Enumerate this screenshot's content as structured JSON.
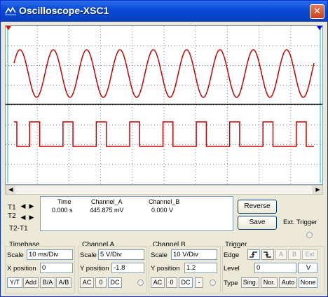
{
  "window": {
    "title": "Oscilloscope-XSC1",
    "close_glyph": "✕"
  },
  "cursor": {
    "t1": "T1",
    "t2": "T2",
    "t2_t1": "T2-T1",
    "left_arrow": "◀",
    "right_arrow": "▶"
  },
  "readout": {
    "headers": {
      "time": "Time",
      "channel_a": "Channel_A",
      "channel_b": "Channel_B"
    },
    "t1_row": {
      "time": "0.000 s",
      "channel_a": "445.875 mV",
      "channel_b": "0.000 V"
    }
  },
  "buttons": {
    "reverse": "Reverse",
    "save": "Save",
    "ext_trigger": "Ext. Trigger"
  },
  "timebase": {
    "title": "Timebase",
    "scale_label": "Scale",
    "scale_value": "10 ms/Div",
    "xpos_label": "X position",
    "xpos_value": "0",
    "modes": [
      "Y/T",
      "Add",
      "B/A",
      "A/B"
    ]
  },
  "channel_a": {
    "title": "Channel A",
    "scale_label": "Scale",
    "scale_value": "5  V/Div",
    "ypos_label": "Y position",
    "ypos_value": "-1.8",
    "coupling": [
      "AC",
      "0",
      "DC"
    ]
  },
  "channel_b": {
    "title": "Channel B",
    "scale_label": "Scale",
    "scale_value": "10  V/Div",
    "ypos_label": "Y position",
    "ypos_value": "1.2",
    "coupling": [
      "AC",
      "0",
      "DC",
      "-"
    ]
  },
  "trigger": {
    "title": "Trigger",
    "edge_label": "Edge",
    "edge_sources": [
      "A",
      "B",
      "Ext"
    ],
    "level_label": "Level",
    "level_value": "0",
    "level_unit": "V",
    "type_label": "Type",
    "types": [
      "Sing.",
      "Nor.",
      "Auto",
      "None"
    ]
  },
  "scope_display": {
    "channel_a": {
      "color": "#cc0000",
      "waveform": "sine",
      "cycles": 9
    },
    "channel_b": {
      "color": "#cc0000",
      "waveform": "square",
      "cycles": 9,
      "duty_fraction": 0.3
    },
    "grid_color": "#7f7f7f",
    "trace_area_background": "#ffffff",
    "marker_1_color": "#ff0000",
    "marker_2_color": "#0000ff",
    "cursor_line_color": "#00c0c0"
  },
  "icons": [
    "oscilloscope-icon",
    "close-icon",
    "left-arrow-icon",
    "right-arrow-icon",
    "edge-rise-icon",
    "edge-fall-icon"
  ]
}
